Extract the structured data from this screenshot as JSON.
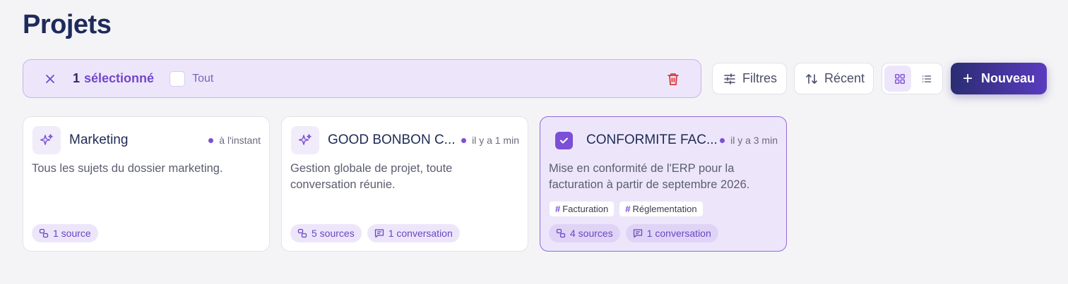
{
  "page": {
    "title": "Projets"
  },
  "selection": {
    "count": "1",
    "count_label": "sélectionné",
    "all_label": "Tout"
  },
  "toolbar": {
    "filters_label": "Filtres",
    "sort_label": "Récent",
    "new_label": "Nouveau"
  },
  "colors": {
    "accent": "#7b4fd6",
    "title": "#1f2a5c",
    "danger": "#d83a3a",
    "new_button_start": "#2b2d72",
    "new_button_end": "#5a3bbf"
  },
  "projects": [
    {
      "name": "Marketing",
      "time": "à l'instant",
      "description": "Tous les sujets du dossier marketing.",
      "icon": "sparkles-icon",
      "selected": false,
      "tags": [],
      "sources": "1 source",
      "conversations": null
    },
    {
      "name": "GOOD BONBON C...",
      "time": "il y a 1 min",
      "description": "Gestion globale de projet, toute conversation réunie.",
      "icon": "sparkles-icon",
      "selected": false,
      "tags": [],
      "sources": "5 sources",
      "conversations": "1 conversation"
    },
    {
      "name": "CONFORMITE FAC...",
      "time": "il y a 3 min",
      "description": "Mise en conformité de l'ERP pour la facturation à partir de septembre 2026.",
      "icon": "checkbox-checked-icon",
      "selected": true,
      "tags": [
        "Facturation",
        "Réglementation"
      ],
      "sources": "4 sources",
      "conversations": "1 conversation"
    }
  ]
}
